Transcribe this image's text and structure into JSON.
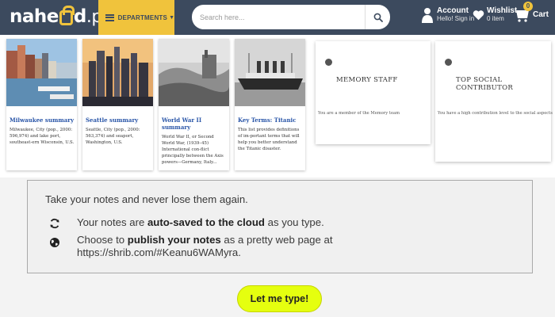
{
  "header": {
    "logo": {
      "part1": "nahe",
      "part2": "d",
      "tld": ".pk"
    },
    "departments_label": "DEPARTMENTS",
    "search": {
      "placeholder": "Search here..."
    },
    "account": {
      "label": "Account",
      "sub": "Hello! Sign in"
    },
    "wishlist": {
      "label": "Wishlist",
      "sub": "0 item"
    },
    "cart": {
      "label": "Cart",
      "count": "0"
    },
    "colors": {
      "header_bg": "#3c4a5e",
      "accent": "#f0c33c"
    }
  },
  "cards": [
    {
      "title": "Milwaukee summary",
      "desc": "Milwaukee, City (pop., 2000: 596,974) and lake port, southeast-ern Wisconsin, U.S."
    },
    {
      "title": "Seattle summary",
      "desc": "Seattle, City (pop., 2000: 563,374) and seaport, Washington, U.S."
    },
    {
      "title": "World War II summary",
      "desc": "World War II, or Second World War, (1939–45) International con-flict principally between the Axis powers—Germany, Italy..."
    },
    {
      "title": "Key Terms: Titanic",
      "desc": "This list provides definitions of im-portant terms that will help you better understand the Titanic disaster."
    }
  ],
  "badges": [
    {
      "title": "MEMORY STAFF",
      "desc": "You are a member of the Memory team"
    },
    {
      "title": "TOP SOCIAL CONTRIBUTOR",
      "desc": "You have a high contribution level to the social aspects"
    }
  ],
  "notes": {
    "intro": "Take your notes and never lose them again.",
    "row1": {
      "pre": "Your notes are ",
      "bold": "auto-saved to the cloud",
      "post": " as you type."
    },
    "row2": {
      "pre": "Choose to ",
      "bold": "publish your notes",
      "post": " as a pretty web page at",
      "url": "https://shrib.com/#Keanu6WAMyra."
    }
  },
  "cta_label": "Let me type!",
  "colors": {
    "cta_bg": "#e5ff0f",
    "link_blue": "#2a56a8"
  }
}
